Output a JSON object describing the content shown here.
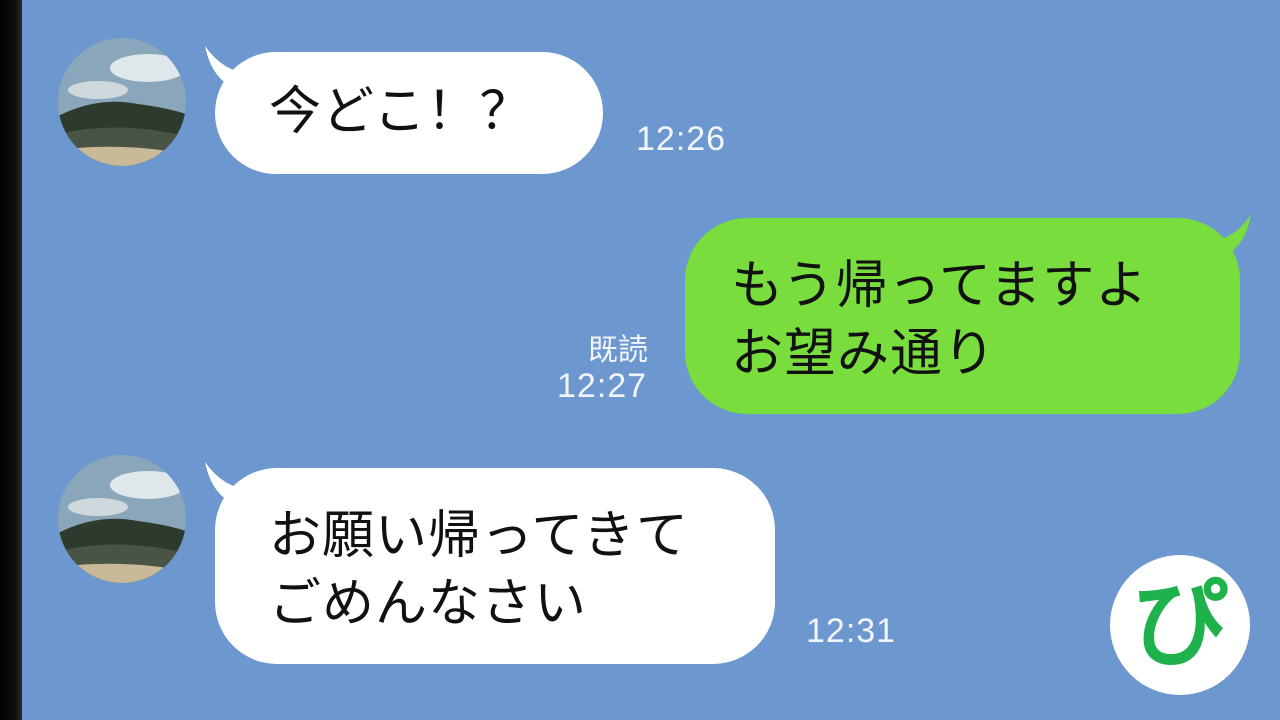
{
  "chat": {
    "messages": [
      {
        "side": "incoming",
        "text": "今どこ！？",
        "time": "12:26"
      },
      {
        "side": "outgoing",
        "text": "もう帰ってますよ\nお望み通り",
        "read": "既読",
        "time": "12:27"
      },
      {
        "side": "incoming",
        "text": "お願い帰ってきて\nごめんなさい",
        "time": "12:31"
      }
    ]
  },
  "watermark": {
    "glyph": "ぴ",
    "color": "#1fb14b"
  },
  "colors": {
    "background": "#6d97cf",
    "incoming_bubble": "#ffffff",
    "outgoing_bubble": "#78dd3d"
  }
}
